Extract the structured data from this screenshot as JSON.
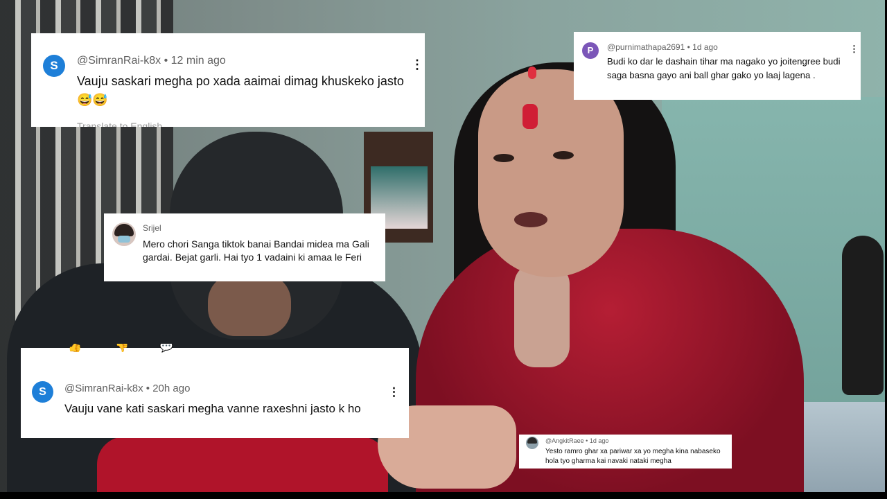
{
  "comments": [
    {
      "avatar_letter": "S",
      "author": "@SimranRai-k8x",
      "time": "12 min ago",
      "text": "Vauju saskari megha po xada aaimai dimag khuskeko jasto 😅😅",
      "cut_text": "Translate to English",
      "menu_icon": "⋮",
      "avatar_color": "#1e7fd8"
    },
    {
      "avatar_letter": "P",
      "author": "@purnimathapa2691",
      "time": "1d ago",
      "text": "Budi ko dar le dashain tihar ma nagako yo joitengree budi saga basna gayo ani ball ghar gako yo laaj lagena .",
      "menu_icon": "⋮",
      "avatar_color": "#7b56b8"
    },
    {
      "author": "Srijel",
      "text": "Mero chori Sanga tiktok banai Bandai midea ma Gali gardai. Bejat garli. Hai tyo 1 vadaini ki amaa le Feri"
    },
    {
      "action_icons": [
        "👍",
        "👎",
        "💬"
      ],
      "avatar_letter": "S",
      "author": "@SimranRai-k8x",
      "time": "20h ago",
      "text": "Vauju vane kati saskari megha vanne raxeshni jasto k ho",
      "menu_icon": "⋮",
      "avatar_color": "#1e7fd8"
    },
    {
      "author": "@AngkitRaee",
      "time": "1d ago",
      "text": "Yesto ramro ghar xa pariwar xa yo megha kina nabaseko hola tyo gharma kai navaki nataki megha"
    }
  ],
  "separator": " • "
}
